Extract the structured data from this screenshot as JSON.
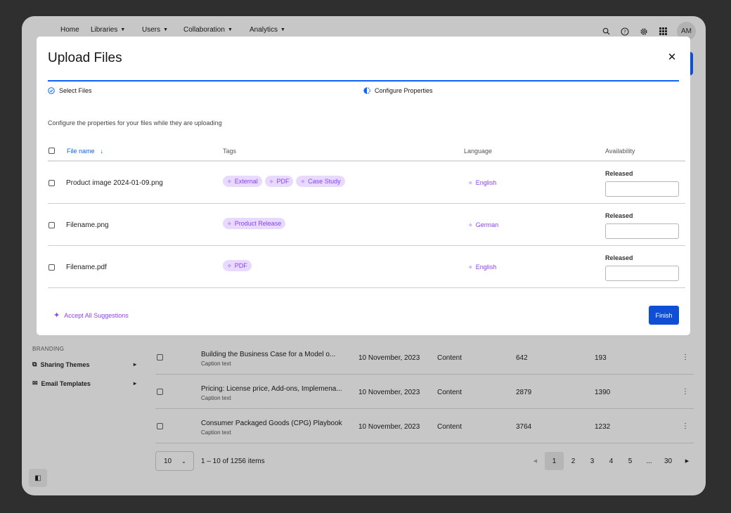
{
  "nav": {
    "items": [
      {
        "label": "Home",
        "dropdown": false
      },
      {
        "label": "Libraries",
        "dropdown": true
      },
      {
        "label": "Users",
        "dropdown": true
      },
      {
        "label": "Collaboration",
        "dropdown": true
      },
      {
        "label": "Analytics",
        "dropdown": true
      }
    ],
    "avatar_initials": "AM",
    "icons": [
      "search-icon",
      "help-icon",
      "settings-icon",
      "apps-grid-icon"
    ]
  },
  "sidebar": {
    "section_branding": "BRANDING",
    "items": [
      {
        "label": "Sharing Themes",
        "icon": "palette-icon"
      },
      {
        "label": "Email Templates",
        "icon": "email-icon"
      }
    ]
  },
  "background_table": {
    "rows": [
      {
        "title": "Building the Business Case for a Model o...",
        "caption": "Caption text",
        "date": "10 November, 2023",
        "type": "Content",
        "n1": "642",
        "n2": "193"
      },
      {
        "title": "Pricing: License price, Add-ons, Implemena...",
        "caption": "Caption text",
        "date": "10 November, 2023",
        "type": "Content",
        "n1": "2879",
        "n2": "1390"
      },
      {
        "title": "Consumer Packaged Goods (CPG) Playbook",
        "caption": "Caption text",
        "date": "10 November, 2023",
        "type": "Content",
        "n1": "3764",
        "n2": "1232"
      }
    ],
    "pager": {
      "page_size": "10",
      "info": "1 – 10 of 1256 items",
      "pages": [
        "1",
        "2",
        "3",
        "4",
        "5",
        "...",
        "30"
      ],
      "active_page": "1"
    }
  },
  "modal": {
    "title": "Upload Files",
    "steps": [
      {
        "label": "Select Files",
        "state": "complete"
      },
      {
        "label": "Configure Properties",
        "state": "current"
      }
    ],
    "subtitle": "Configure the properties for your files while they are uploading",
    "columns": {
      "file_name": "File name",
      "tags": "Tags",
      "language": "Language",
      "availability": "Availability"
    },
    "rows": [
      {
        "file": "Product image 2024-01-09.png",
        "tags": [
          "External",
          "PDF",
          "Case Study"
        ],
        "language": "English",
        "availability": "Released"
      },
      {
        "file": "Filename.png",
        "tags": [
          "Product Release"
        ],
        "language": "German",
        "availability": "Released"
      },
      {
        "file": "Filename.pdf",
        "tags": [
          "PDF"
        ],
        "language": "English",
        "availability": "Released"
      }
    ],
    "accept_all": "Accept All Suggestions",
    "finish": "Finish"
  },
  "colors": {
    "accent": "#0f62fe",
    "primary_button": "#0f4fd6",
    "ai_purple": "#8a3ffc",
    "tag_bg": "#e8daff"
  }
}
